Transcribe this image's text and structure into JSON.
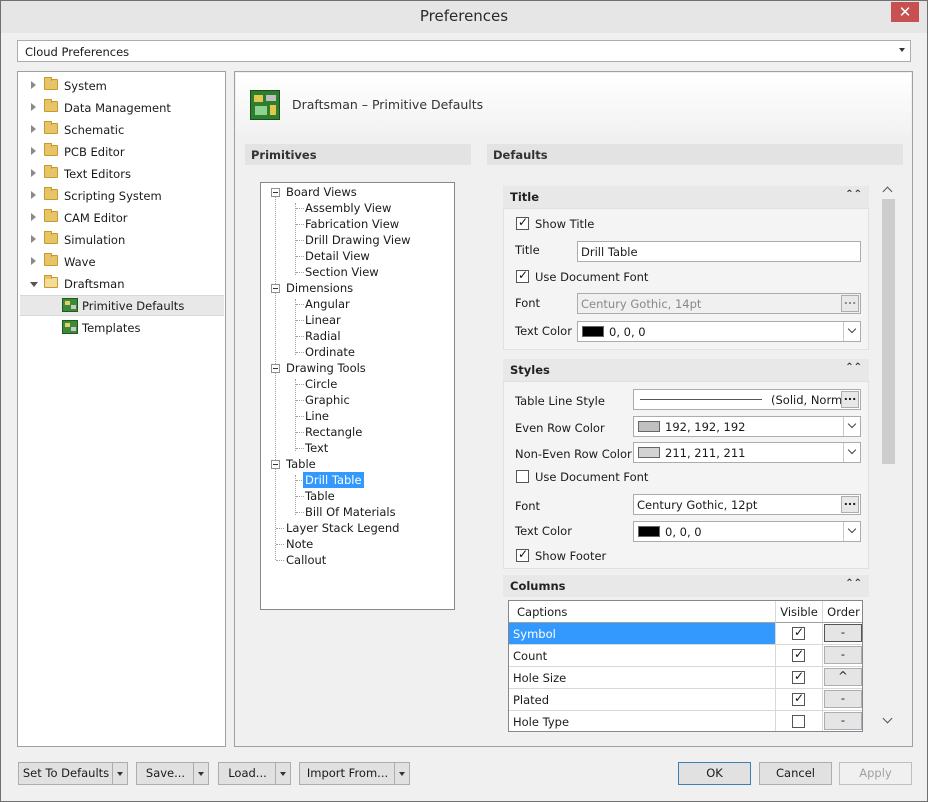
{
  "window": {
    "title": "Preferences",
    "close_glyph": "✕"
  },
  "cloud_combo": {
    "value": "Cloud Preferences"
  },
  "nav": {
    "items": [
      {
        "label": "System"
      },
      {
        "label": "Data Management"
      },
      {
        "label": "Schematic"
      },
      {
        "label": "PCB Editor"
      },
      {
        "label": "Text Editors"
      },
      {
        "label": "Scripting System"
      },
      {
        "label": "CAM Editor"
      },
      {
        "label": "Simulation"
      },
      {
        "label": "Wave"
      },
      {
        "label": "Draftsman"
      }
    ],
    "children": [
      {
        "label": "Primitive Defaults"
      },
      {
        "label": "Templates"
      }
    ]
  },
  "page": {
    "title": "Draftsman – Primitive Defaults",
    "primitives_label": "Primitives",
    "defaults_label": "Defaults"
  },
  "tree": {
    "nodes": [
      {
        "label": "Board Views"
      },
      {
        "label": "Assembly View"
      },
      {
        "label": "Fabrication View"
      },
      {
        "label": "Drill Drawing View"
      },
      {
        "label": "Detail View"
      },
      {
        "label": "Section View"
      },
      {
        "label": "Dimensions"
      },
      {
        "label": "Angular"
      },
      {
        "label": "Linear"
      },
      {
        "label": "Radial"
      },
      {
        "label": "Ordinate"
      },
      {
        "label": "Drawing Tools"
      },
      {
        "label": "Circle"
      },
      {
        "label": "Graphic"
      },
      {
        "label": "Line"
      },
      {
        "label": "Rectangle"
      },
      {
        "label": "Text"
      },
      {
        "label": "Table"
      },
      {
        "label": "Drill Table"
      },
      {
        "label": "Table"
      },
      {
        "label": "Bill Of Materials"
      },
      {
        "label": "Layer Stack Legend"
      },
      {
        "label": "Note"
      },
      {
        "label": "Callout"
      }
    ]
  },
  "title_group": {
    "header": "Title",
    "show_title": "Show Title",
    "title_label": "Title",
    "title_value": "Drill Table",
    "use_doc_font": "Use Document Font",
    "font_label": "Font",
    "font_value": "Century Gothic, 14pt",
    "text_color_label": "Text Color",
    "text_color_value": "0, 0, 0"
  },
  "styles_group": {
    "header": "Styles",
    "line_style_label": "Table Line Style",
    "line_style_value": "(Solid, Normal)",
    "even_label": "Even Row Color",
    "even_value": "192, 192, 192",
    "noneven_label": "Non-Even Row Color",
    "noneven_value": "211, 211, 211",
    "use_doc_font": "Use Document Font",
    "font_label": "Font",
    "font_value": "Century Gothic, 12pt",
    "text_color_label": "Text Color",
    "text_color_value": "0, 0, 0",
    "show_footer": "Show Footer"
  },
  "columns_group": {
    "header": "Columns",
    "col_captions": "Captions",
    "col_visible": "Visible",
    "col_order": "Order",
    "rows": [
      {
        "caption": "Symbol",
        "order": "-"
      },
      {
        "caption": "Count",
        "order": "-"
      },
      {
        "caption": "Hole Size",
        "order": "^"
      },
      {
        "caption": "Plated",
        "order": "-"
      },
      {
        "caption": "Hole Type",
        "order": "-"
      }
    ]
  },
  "buttons": {
    "set_defaults": "Set To Defaults",
    "save": "Save...",
    "load": "Load...",
    "import": "Import From...",
    "ok": "OK",
    "cancel": "Cancel",
    "apply": "Apply"
  },
  "colors": {
    "selection": "#3399ff",
    "swatch_black": "#000000",
    "swatch_even": "#c0c0c0",
    "swatch_noneven": "#d3d3d3"
  }
}
